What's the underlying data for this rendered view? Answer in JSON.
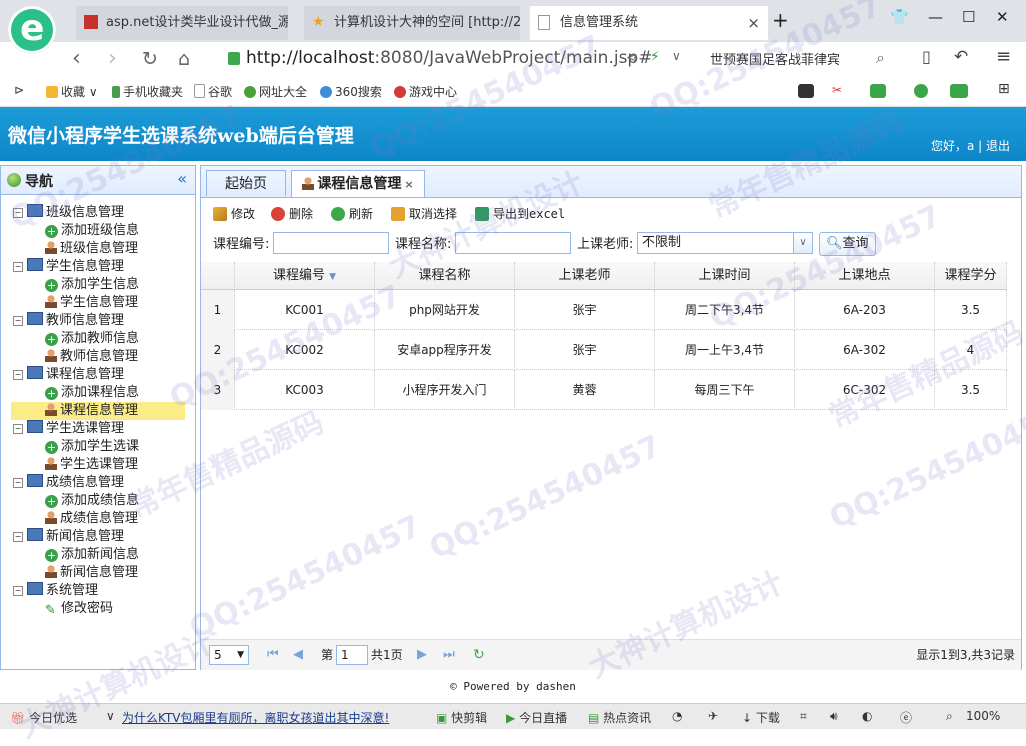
{
  "browser": {
    "tabs": [
      {
        "title": "asp.net设计类毕业设计代做_源"
      },
      {
        "title": "计算机设计大神的空间 [http://2"
      },
      {
        "title": "信息管理系统",
        "close": "×"
      }
    ],
    "new_tab": "+",
    "url_host": "http://localhost",
    "url_path": ":8080/JavaWebProject/main.jsp#",
    "search_hint": "世预赛国足客战菲律宾"
  },
  "bookmarks": [
    "收藏",
    "手机收藏夹",
    "谷歌",
    "网址大全",
    "360搜索",
    "游戏中心"
  ],
  "app": {
    "title": "微信小程序学生选课系统web端后台管理",
    "welcome": "您好，a | 退出"
  },
  "sidebar": {
    "title": "导航",
    "groups": [
      {
        "label": "班级信息管理",
        "items": [
          "添加班级信息",
          "班级信息管理"
        ]
      },
      {
        "label": "学生信息管理",
        "items": [
          "添加学生信息",
          "学生信息管理"
        ]
      },
      {
        "label": "教师信息管理",
        "items": [
          "添加教师信息",
          "教师信息管理"
        ]
      },
      {
        "label": "课程信息管理",
        "items": [
          "添加课程信息",
          "课程信息管理"
        ]
      },
      {
        "label": "学生选课管理",
        "items": [
          "添加学生选课",
          "学生选课管理"
        ]
      },
      {
        "label": "成绩信息管理",
        "items": [
          "添加成绩信息",
          "成绩信息管理"
        ]
      },
      {
        "label": "新闻信息管理",
        "items": [
          "添加新闻信息",
          "新闻信息管理"
        ]
      },
      {
        "label": "系统管理",
        "items": [
          "修改密码"
        ]
      }
    ],
    "selected": "课程信息管理"
  },
  "main": {
    "tabs": [
      {
        "label": "起始页"
      },
      {
        "label": "课程信息管理",
        "close": "×"
      }
    ],
    "toolbar": {
      "edit": "修改",
      "delete": "删除",
      "refresh": "刷新",
      "cancel_select": "取消选择",
      "export": "导出到excel"
    },
    "filters": {
      "course_no_label": "课程编号:",
      "course_no_value": "",
      "course_name_label": "课程名称:",
      "course_name_value": "",
      "teacher_label": "上课老师:",
      "teacher_value": "不限制",
      "query_button": "查询"
    },
    "table": {
      "columns": [
        "课程编号",
        "课程名称",
        "上课老师",
        "上课时间",
        "上课地点",
        "课程学分"
      ],
      "rows": [
        {
          "n": "1",
          "cells": [
            "KC001",
            "php网站开发",
            "张宇",
            "周二下午3,4节",
            "6A-203",
            "3.5"
          ]
        },
        {
          "n": "2",
          "cells": [
            "KC002",
            "安卓app程序开发",
            "张宇",
            "周一上午3,4节",
            "6A-302",
            "4"
          ]
        },
        {
          "n": "3",
          "cells": [
            "KC003",
            "小程序开发入门",
            "黄蓉",
            "每周三下午",
            "6C-302",
            "3.5"
          ]
        }
      ]
    },
    "pager": {
      "page_size": "5",
      "page_prefix": "第",
      "page_value": "1",
      "page_total": "共1页",
      "summary": "显示1到3,共3记录"
    }
  },
  "footer": "© Powered by dashen",
  "statusbar": {
    "news_label": "今日优选",
    "news_link": "为什么KTV包厢里有厕所，离职女孩道出其中深意!",
    "items": [
      "快剪辑",
      "今日直播",
      "热点资讯"
    ],
    "download": "下载",
    "zoom": "100%"
  },
  "watermarks": [
    "QQ:254540457",
    "大神计算机设计",
    "常年售精品源码"
  ]
}
